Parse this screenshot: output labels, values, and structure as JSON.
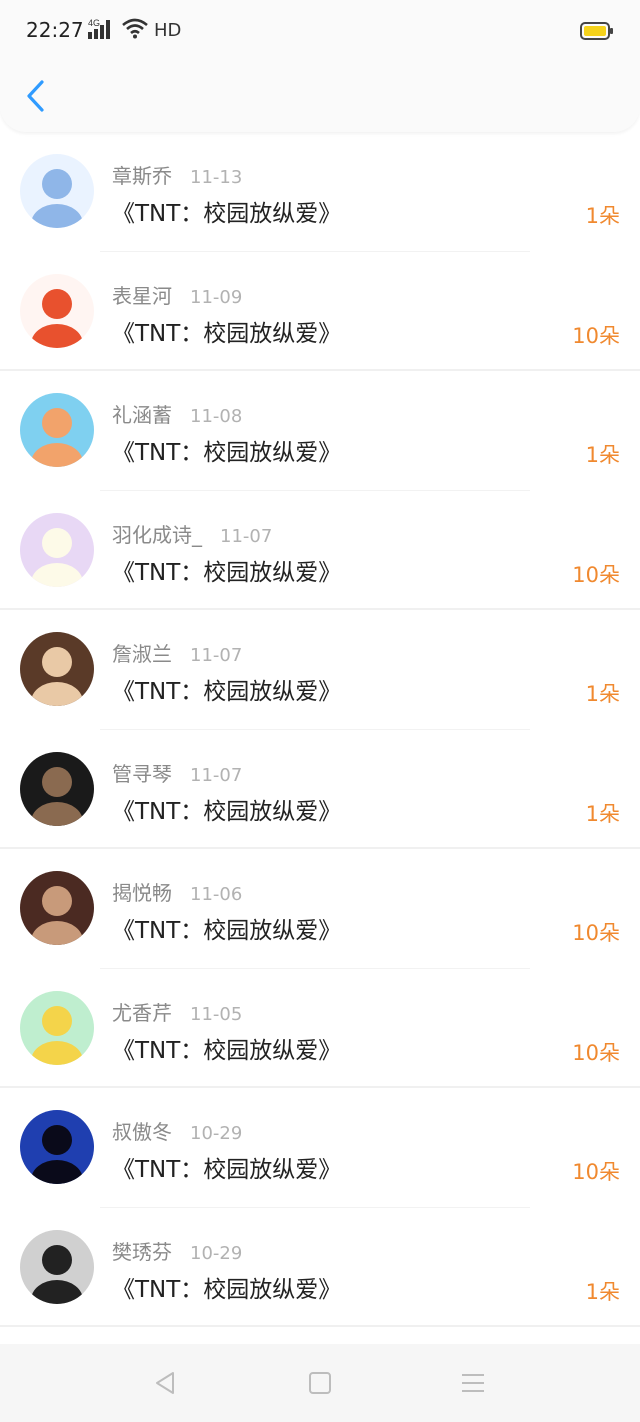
{
  "status": {
    "time": "22:27",
    "network": "4G",
    "hd": "HD"
  },
  "header": {
    "back_icon": "chevron-left-icon",
    "accent": "#2f9bff"
  },
  "colors": {
    "amount": "#f0892f",
    "battery": "#f5d21b"
  },
  "items": [
    {
      "name": "章斯乔",
      "date": "11-13",
      "title": "《TNT：校园放纵爱》",
      "amount": "1朵",
      "avatar_bg": "#eaf3ff",
      "avatar_fg": "#8fb6e8"
    },
    {
      "name": "表星河",
      "date": "11-09",
      "title": "《TNT：校园放纵爱》",
      "amount": "10朵",
      "avatar_bg": "#fff5f2",
      "avatar_fg": "#e8512e"
    },
    {
      "name": "礼涵蓄",
      "date": "11-08",
      "title": "《TNT：校园放纵爱》",
      "amount": "1朵",
      "avatar_bg": "#7fd0f0",
      "avatar_fg": "#f2a36b"
    },
    {
      "name": "羽化成诗_",
      "date": "11-07",
      "title": "《TNT：校园放纵爱》",
      "amount": "10朵",
      "avatar_bg": "#e8d8f5",
      "avatar_fg": "#fdfae8"
    },
    {
      "name": "詹淑兰",
      "date": "11-07",
      "title": "《TNT：校园放纵爱》",
      "amount": "1朵",
      "avatar_bg": "#5a3a28",
      "avatar_fg": "#e9c9a6"
    },
    {
      "name": "管寻琴",
      "date": "11-07",
      "title": "《TNT：校园放纵爱》",
      "amount": "1朵",
      "avatar_bg": "#1a1a1a",
      "avatar_fg": "#8a6a50"
    },
    {
      "name": "揭悦畅",
      "date": "11-06",
      "title": "《TNT：校园放纵爱》",
      "amount": "10朵",
      "avatar_bg": "#4b2a22",
      "avatar_fg": "#c89a7a"
    },
    {
      "name": "尤香芹",
      "date": "11-05",
      "title": "《TNT：校园放纵爱》",
      "amount": "10朵",
      "avatar_bg": "#bfeecf",
      "avatar_fg": "#f4d44a"
    },
    {
      "name": "叔傲冬",
      "date": "10-29",
      "title": "《TNT：校园放纵爱》",
      "amount": "10朵",
      "avatar_bg": "#1f3fb0",
      "avatar_fg": "#0a0a1a"
    },
    {
      "name": "樊琇芬",
      "date": "10-29",
      "title": "《TNT：校园放纵爱》",
      "amount": "1朵",
      "avatar_bg": "#d0d0d0",
      "avatar_fg": "#222222"
    }
  ],
  "nav": {
    "back": "triangle-back-icon",
    "home": "square-home-icon",
    "menu": "menu-lines-icon"
  }
}
